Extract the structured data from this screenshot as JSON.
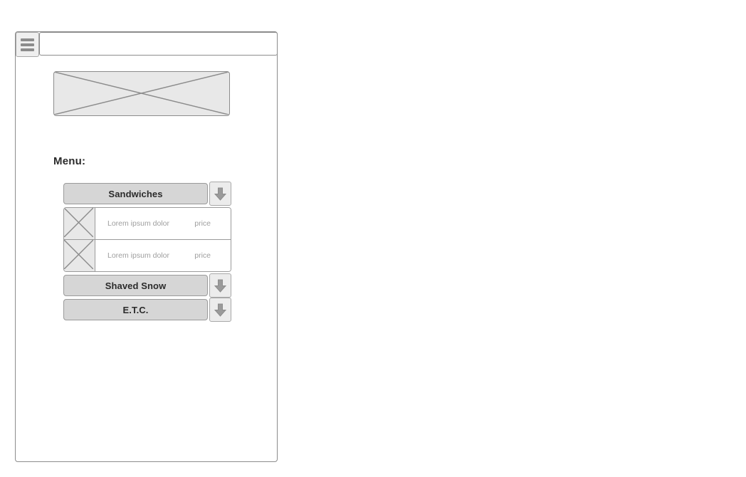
{
  "device": {
    "name": "mobile-wireframe-frame"
  },
  "app_bar": {
    "menu_icon": "hamburger-icon",
    "search": {
      "value": "",
      "placeholder": ""
    }
  },
  "hero": {
    "placeholder_label": "image-placeholder"
  },
  "page": {
    "heading": "Menu:"
  },
  "accordion": {
    "toggle_icon": "arrow-down-icon",
    "sections": [
      {
        "label": "Sandwiches",
        "expanded": true,
        "items": [
          {
            "thumb": "image-placeholder",
            "name": "Lorem ipsum dolor",
            "price": "price"
          },
          {
            "thumb": "image-placeholder",
            "name": "Lorem ipsum dolor",
            "price": "price"
          }
        ]
      },
      {
        "label": "Shaved Snow",
        "expanded": false,
        "items": []
      },
      {
        "label": "E.T.C.",
        "expanded": false,
        "items": []
      }
    ]
  },
  "colors": {
    "stroke": "#8c8c8c",
    "header_fill": "#d6d6d6",
    "placeholder_fill": "#e8e8e8",
    "button_fill": "#ececec",
    "muted_text": "#9e9e9e",
    "dark_text": "#2b2b2b",
    "page_background": "#ffffff"
  }
}
